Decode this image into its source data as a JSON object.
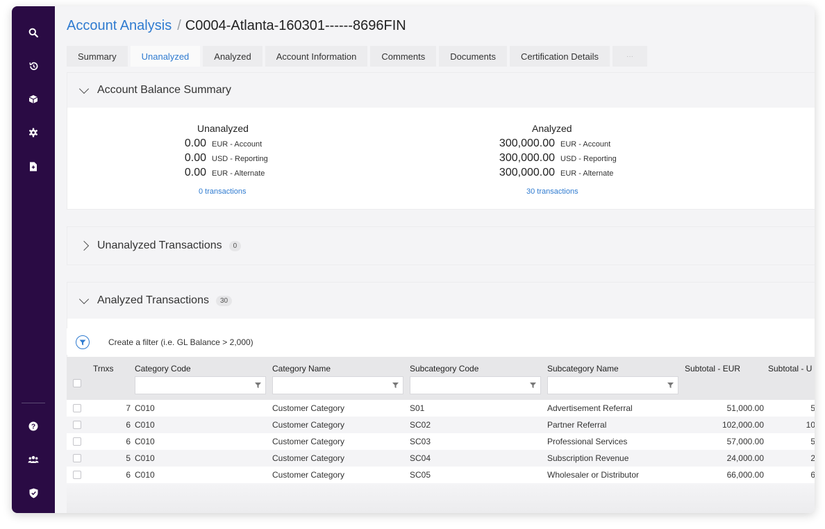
{
  "breadcrumb": {
    "root": "Account Analysis",
    "separator": "/",
    "current": "C0004-Atlanta-160301------8696FIN"
  },
  "tabs": [
    {
      "label": "Summary"
    },
    {
      "label": "Unanalyzed",
      "active": true
    },
    {
      "label": "Analyzed"
    },
    {
      "label": "Account Information"
    },
    {
      "label": "Comments"
    },
    {
      "label": "Documents"
    },
    {
      "label": "Certification Details"
    },
    {
      "label": "···"
    }
  ],
  "sidebar": {
    "icons": [
      "search-icon",
      "history-icon",
      "cube-icon",
      "gear-icon",
      "document-icon",
      "help-icon",
      "users-icon",
      "shield-icon"
    ]
  },
  "balance_summary": {
    "title": "Account Balance Summary",
    "unanalyzed": {
      "title": "Unanalyzed",
      "rows": [
        {
          "value": "0.00",
          "unit": "EUR - Account"
        },
        {
          "value": "0.00",
          "unit": "USD - Reporting"
        },
        {
          "value": "0.00",
          "unit": "EUR - Alternate"
        }
      ],
      "link": "0 transactions"
    },
    "analyzed": {
      "title": "Analyzed",
      "rows": [
        {
          "value": "300,000.00",
          "unit": "EUR - Account"
        },
        {
          "value": "300,000.00",
          "unit": "USD - Reporting"
        },
        {
          "value": "300,000.00",
          "unit": "EUR - Alternate"
        }
      ],
      "link": "30 transactions"
    }
  },
  "unanalyzed_section": {
    "title": "Unanalyzed Transactions",
    "count": "0"
  },
  "analyzed_section": {
    "title": "Analyzed Transactions",
    "count": "30"
  },
  "filter": {
    "placeholder": "Create a filter (i.e. GL Balance > 2,000)"
  },
  "grid": {
    "columns": [
      "Trnxs",
      "Category Code",
      "Category Name",
      "Subcategory Code",
      "Subcategory Name",
      "Subtotal - EUR",
      "Subtotal - U"
    ],
    "rows": [
      {
        "trnxs": "7",
        "cat_code": "C010",
        "cat_name": "Customer Category",
        "sub_code": "S01",
        "sub_name": "Advertisement Referral",
        "subtotal_eur": "51,000.00",
        "subtotal_u": "5"
      },
      {
        "trnxs": "6",
        "cat_code": "C010",
        "cat_name": "Customer Category",
        "sub_code": "SC02",
        "sub_name": "Partner Referral",
        "subtotal_eur": "102,000.00",
        "subtotal_u": "10"
      },
      {
        "trnxs": "6",
        "cat_code": "C010",
        "cat_name": "Customer Category",
        "sub_code": "SC03",
        "sub_name": "Professional Services",
        "subtotal_eur": "57,000.00",
        "subtotal_u": "5"
      },
      {
        "trnxs": "5",
        "cat_code": "C010",
        "cat_name": "Customer Category",
        "sub_code": "SC04",
        "sub_name": "Subscription Revenue",
        "subtotal_eur": "24,000.00",
        "subtotal_u": "2"
      },
      {
        "trnxs": "6",
        "cat_code": "C010",
        "cat_name": "Customer Category",
        "sub_code": "SC05",
        "sub_name": "Wholesaler or Distributor",
        "subtotal_eur": "66,000.00",
        "subtotal_u": "6"
      }
    ]
  },
  "colors": {
    "sidebar": "#2a0b44",
    "accent": "#2f7bd0"
  }
}
